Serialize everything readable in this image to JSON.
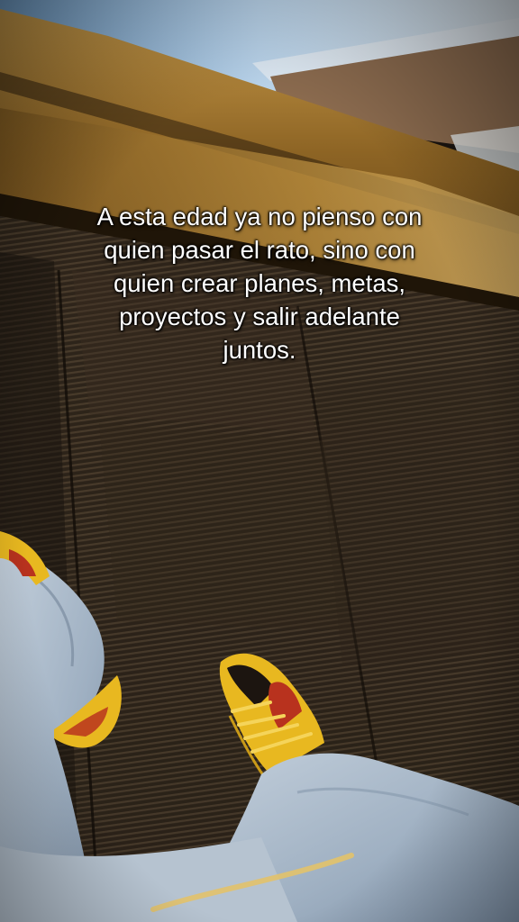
{
  "overlay": {
    "caption": "A esta edad ya no pienso con\nquien pasar el rato, sino con\nquien crear planes, metas,\nproyectos y salir adelante\njuntos."
  },
  "scene": {
    "description_icon": "escalator-photo",
    "colors": {
      "ceiling": "#8fb6d8",
      "handrail_gold": "#a8782a",
      "step_dark": "#2a2219",
      "shoe_yellow": "#e8b820",
      "shoe_red": "#b8321e",
      "denim": "#a9b8c8"
    }
  }
}
